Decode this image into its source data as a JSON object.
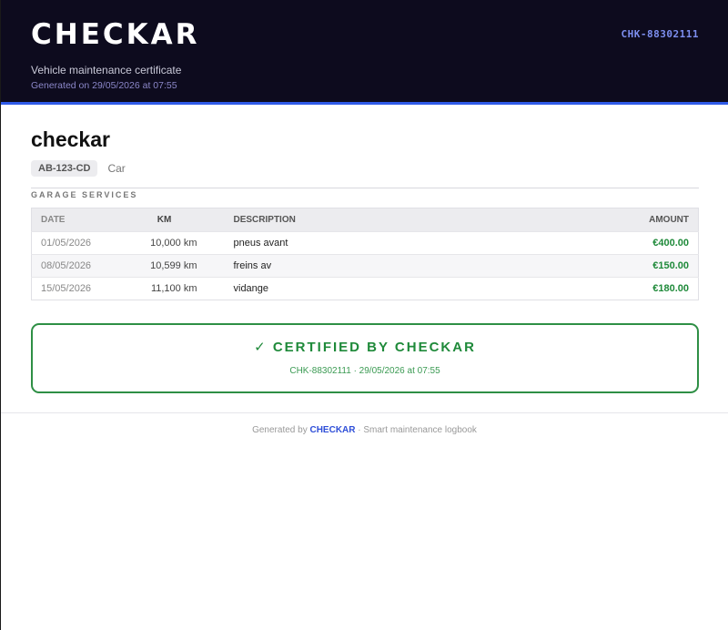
{
  "header": {
    "brand": "CHECKAR",
    "subtitle": "Vehicle maintenance certificate",
    "generated": "Generated on 29/05/2026 at 07:55",
    "certificate_code": "CHK-88302111"
  },
  "vehicle": {
    "name": "checkar",
    "plate": "AB-123-CD",
    "type": "Car"
  },
  "services": {
    "section_title": "GARAGE SERVICES",
    "columns": {
      "date": "DATE",
      "km": "KM",
      "description": "DESCRIPTION",
      "amount": "AMOUNT"
    },
    "rows": [
      {
        "date": "01/05/2026",
        "km": "10,000 km",
        "description": "pneus avant",
        "amount": "€400.00"
      },
      {
        "date": "08/05/2026",
        "km": "10,599 km",
        "description": "freins av",
        "amount": "€150.00"
      },
      {
        "date": "15/05/2026",
        "km": "11,100 km",
        "description": "vidange",
        "amount": "€180.00"
      }
    ]
  },
  "certification": {
    "check_icon": "check-icon",
    "title": "✓ CERTIFIED BY CHECKAR",
    "details": "CHK-88302111 · 29/05/2026 at 07:55"
  },
  "footer": {
    "prefix": "Generated by",
    "brand": "CHECKAR",
    "suffix": "· Smart maintenance logbook"
  },
  "colors": {
    "header_bg": "#0d0b1e",
    "accent": "#2f5be8",
    "certified_green": "#1f8a3a"
  }
}
